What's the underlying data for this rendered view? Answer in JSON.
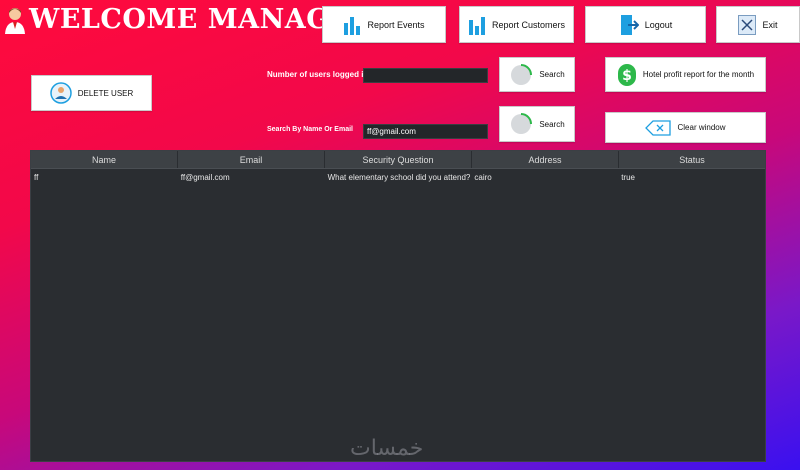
{
  "header": {
    "title": "WELCOME MANAGER"
  },
  "toolbar": {
    "report_events": "Report Events",
    "report_customers": "Report Customers",
    "logout": "Logout",
    "exit": "Exit"
  },
  "actions": {
    "delete_user": "DELETE USER",
    "search1": "Search",
    "search2": "Search",
    "hotel_profit": "Hotel profit report for the month",
    "clear_window": "Clear window"
  },
  "fields": {
    "users_logged_label": "Number of users logged in",
    "users_logged_value": "",
    "search_label": "Search By Name Or Email",
    "search_value": "ff@gmail.com"
  },
  "table": {
    "columns": [
      "Name",
      "Email",
      "Security  Question",
      "Address",
      "Status"
    ],
    "rows": [
      [
        "ff",
        "ff@gmail.com",
        "What elementary school did you attend?",
        "cairo",
        "true"
      ]
    ]
  },
  "watermark": "خمسات",
  "colors": {
    "accent_blue": "#1e9fe0",
    "accent_green": "#2db84a"
  }
}
